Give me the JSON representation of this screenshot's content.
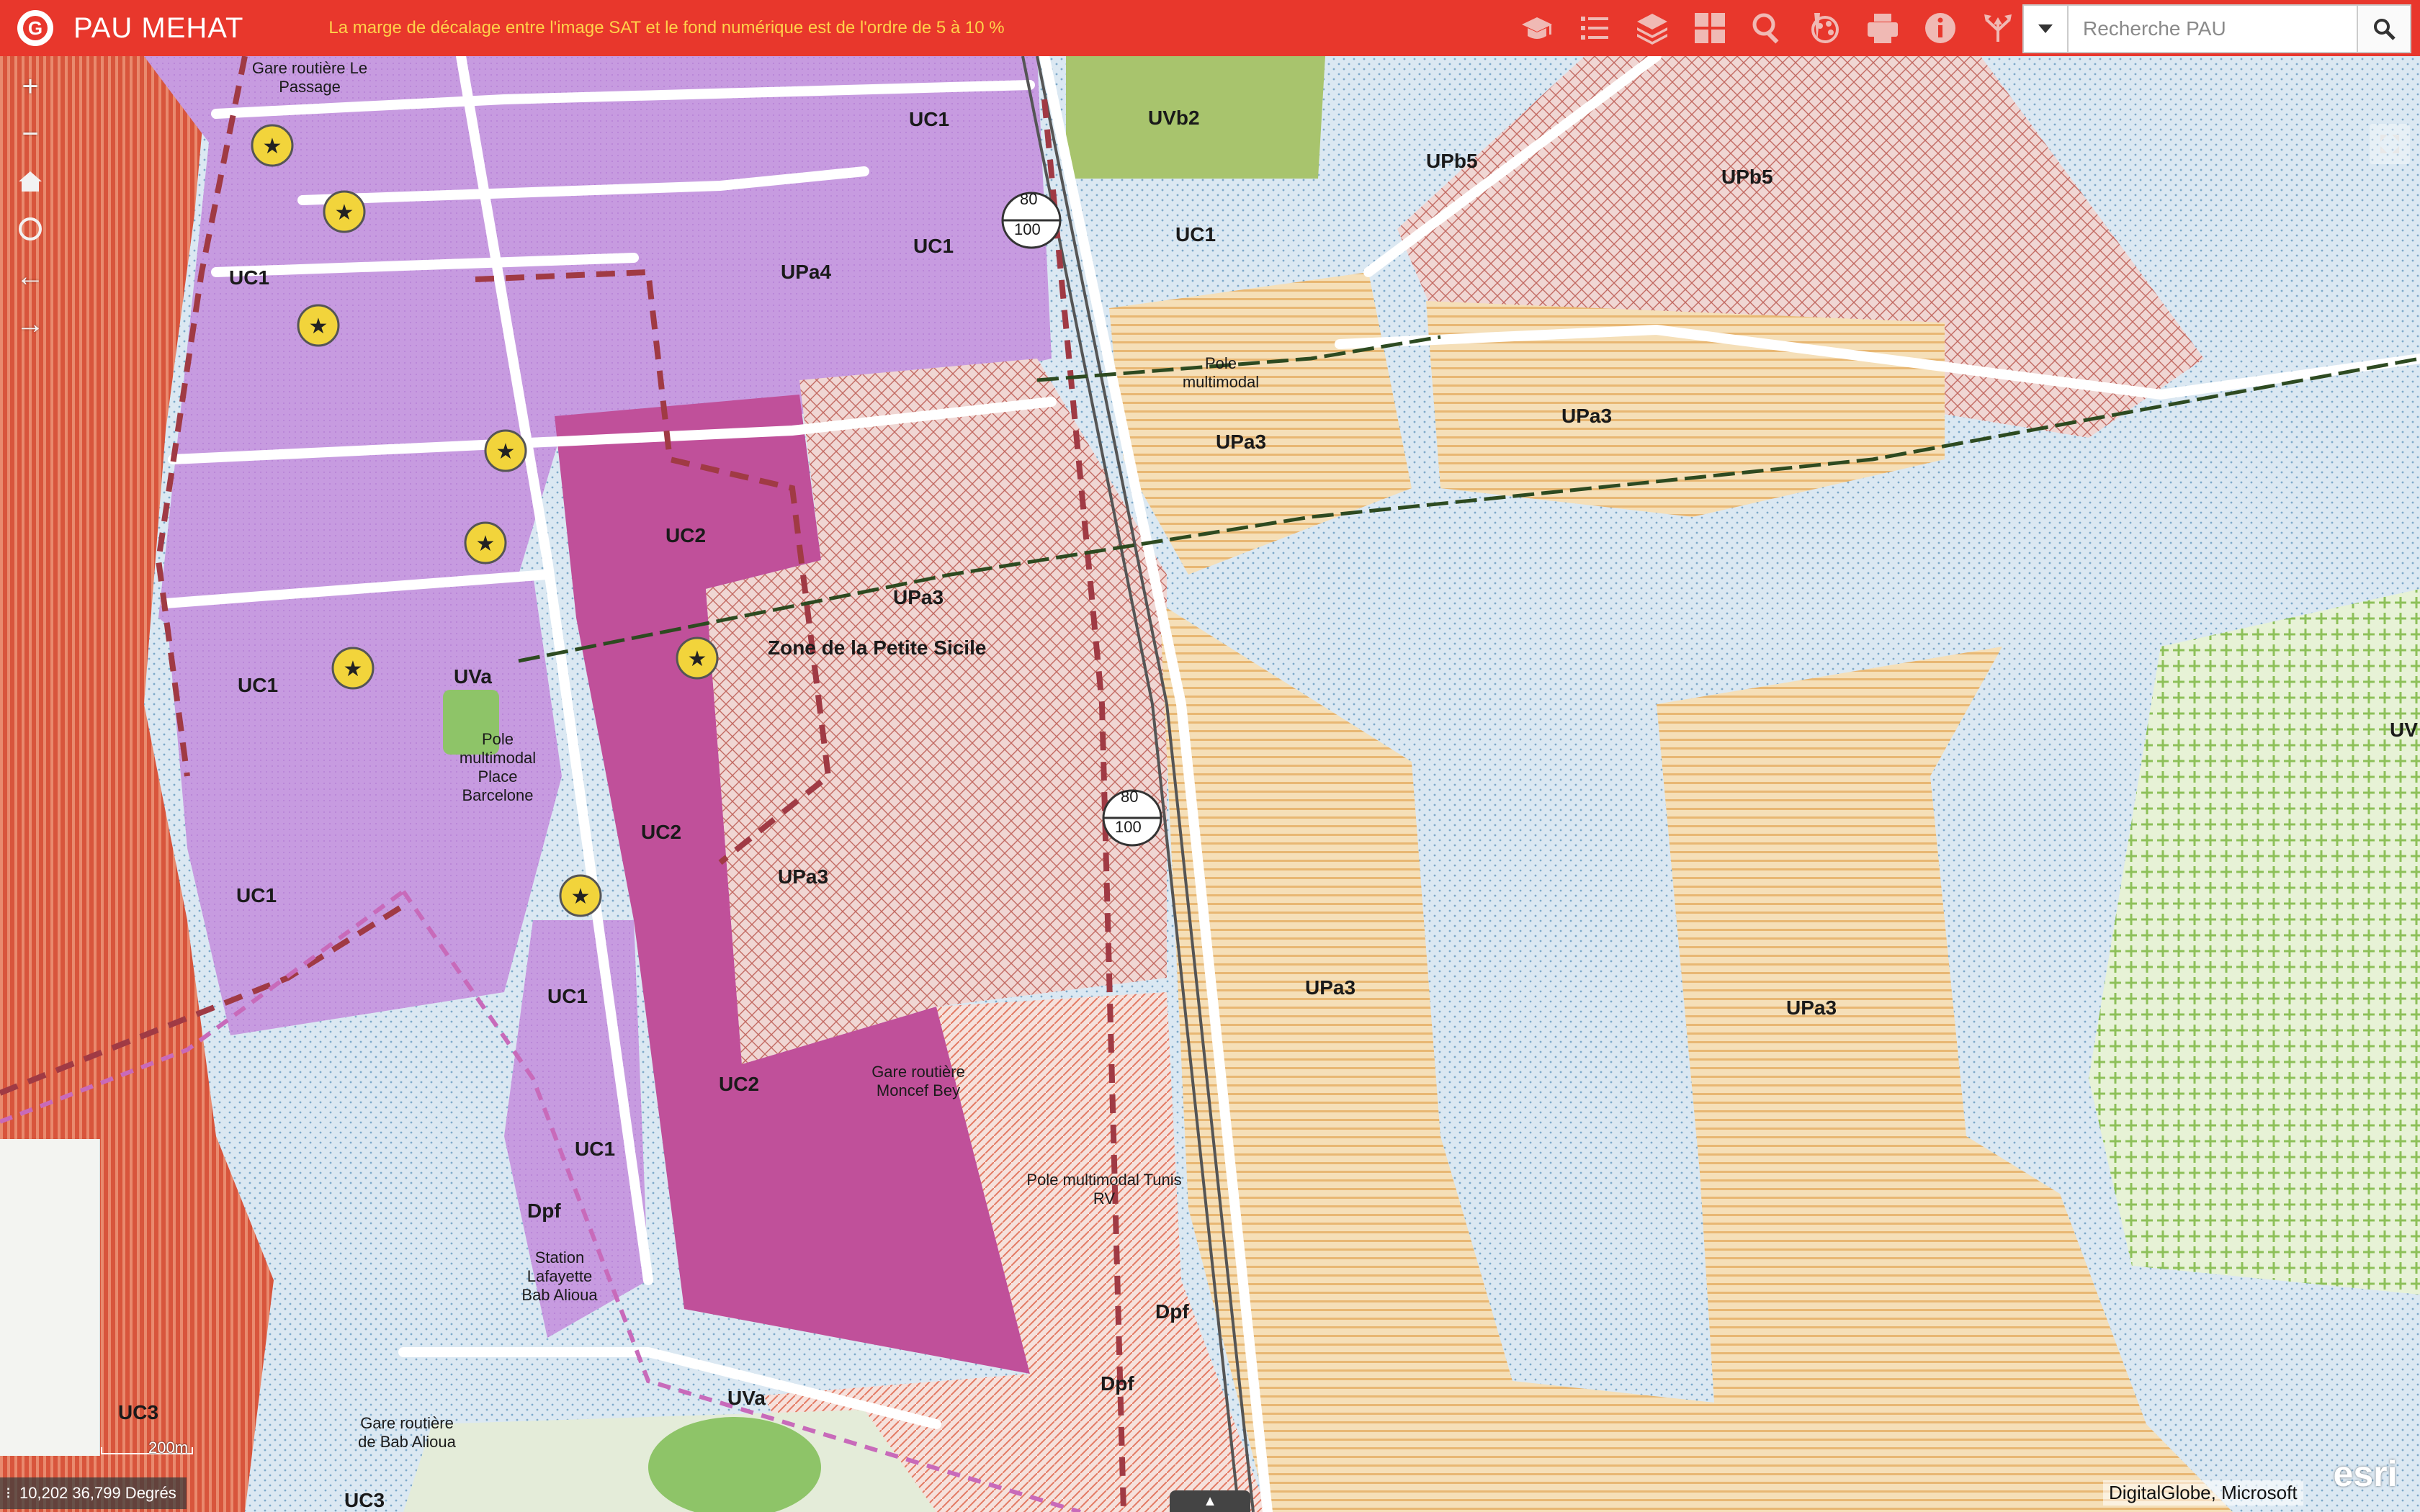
{
  "header": {
    "title": "PAU MEHAT",
    "subtitle": "La marge de décalage entre l'image SAT et le fond numérique est de l'ordre de 5 à 10 %",
    "logo_icon": "app-logo-icon",
    "background_color": "#e8372c",
    "subtitle_color": "#ffd24a"
  },
  "toolbar": {
    "tools": [
      {
        "name": "about-hat-icon"
      },
      {
        "name": "legend-list-icon"
      },
      {
        "name": "layers-icon"
      },
      {
        "name": "basemap-grid-icon"
      },
      {
        "name": "measure-search-icon"
      },
      {
        "name": "draw-tool-icon"
      },
      {
        "name": "print-icon"
      },
      {
        "name": "info-icon"
      },
      {
        "name": "share-icon"
      }
    ]
  },
  "search": {
    "placeholder": "Recherche PAU",
    "value": ""
  },
  "map": {
    "labels": {
      "l1": "UC1",
      "l2": "UVb2",
      "l3": "UPb5",
      "l4": "UPb5",
      "l5": "UC1",
      "l6": "UC1",
      "l7": "UPa4",
      "l8": "UC1",
      "l9": "Pole multimodal",
      "l10": "UPa3",
      "l11": "UPa3",
      "l12": "UC2",
      "l13": "UPa3",
      "l14": "Zone de la Petite Sicile",
      "l15": "UC1",
      "l16": "UVa",
      "l17": "Pole multimodal Place Barcelone",
      "l18": "UC2",
      "l19": "UPa3",
      "l20": "UC1",
      "l21": "UPa3",
      "l22": "UPa3",
      "l23": "UC1",
      "l24": "UC2",
      "l25": "Gare routière Moncef Bey",
      "l26": "UC1",
      "l27": "Pole multimodal Tunis RV",
      "l28": "Dpf",
      "l29": "Dpf",
      "l30": "Dpf",
      "l31": "UVa",
      "l32": "UC3",
      "l33": "UC3",
      "l34": "Gare routière Le Passage",
      "l35": "Gare routière de Bab Alioua",
      "l36": "Station Lafayette Bab Alioua",
      "l37": "UV",
      "l38": "80",
      "l39": "100",
      "l40": "80",
      "l41": "100"
    }
  },
  "controls": {
    "zoom_in": "+",
    "zoom_out": "−",
    "home_icon": "home-icon",
    "locate_icon": "locate-icon",
    "back": "←",
    "forward": "→"
  },
  "status": {
    "coordinates": "10,202 36,799 Degrés",
    "scale": "200m",
    "attribution": "DigitalGlobe, Microsoft",
    "esri": "esri"
  }
}
